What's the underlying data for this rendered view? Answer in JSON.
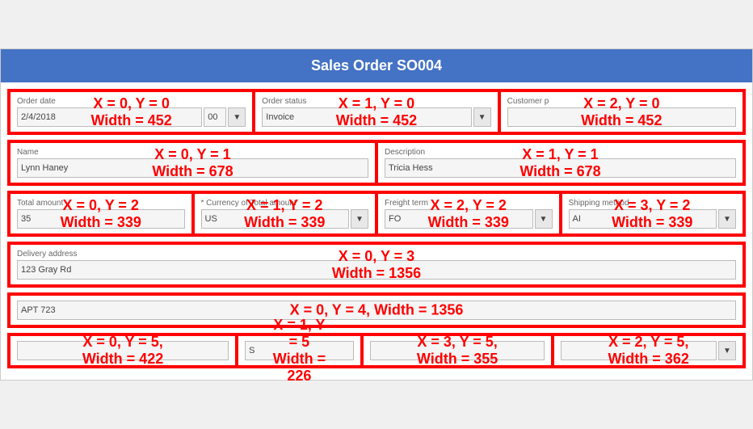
{
  "title": "Sales Order SO004",
  "rows": [
    {
      "id": "row0",
      "cells": [
        {
          "label": "Order date",
          "coords": "X = 0, Y = 0",
          "width": "Width = 452",
          "input_value": "2/4/2018",
          "has_time": true,
          "time_value": "00",
          "has_select": true
        },
        {
          "label": "Order status",
          "coords": "X = 1, Y = 0",
          "width": "Width = 452",
          "input_value": "Invoice",
          "has_select": true
        },
        {
          "label": "Customer p",
          "coords": "X = 2, Y = 0",
          "width": "Width = 452",
          "input_value": "",
          "has_select": false
        }
      ]
    },
    {
      "id": "row1",
      "cells": [
        {
          "label": "Name",
          "coords": "X = 0, Y = 1",
          "width": "Width = 678",
          "input_value": "Lynn Haney",
          "has_select": false
        },
        {
          "label": "Description",
          "coords": "X = 1, Y = 1",
          "width": "Width = 678",
          "input_value": "Tricia Hess",
          "has_select": false
        }
      ]
    },
    {
      "id": "row2",
      "cells": [
        {
          "label": "Total amount",
          "coords": "X = 0, Y = 2",
          "width": "Width = 339",
          "input_value": "35",
          "has_select": false
        },
        {
          "label": "* Currency of Total amount",
          "coords": "X = 1, Y = 2",
          "width": "Width = 339",
          "input_value": "US",
          "has_select": true
        },
        {
          "label": "Freight term",
          "coords": "X = 2, Y = 2",
          "width": "Width = 339",
          "input_value": "FO",
          "has_select": true
        },
        {
          "label": "Shipping method",
          "coords": "X = 3, Y = 2",
          "width": "Width = 339",
          "input_value": "AI",
          "has_select": true
        }
      ]
    },
    {
      "id": "row3",
      "cells": [
        {
          "label": "Delivery address",
          "coords": "X = 0, Y = 3",
          "width": "Width = 1356",
          "input_value": "123 Gray Rd",
          "has_select": false
        }
      ]
    },
    {
      "id": "row4",
      "cells": [
        {
          "label": "",
          "coords": "X = 0, Y = 4, Width = 1356",
          "width": "",
          "input_value": "APT 723",
          "has_select": false
        }
      ]
    }
  ],
  "row5": {
    "cells": [
      {
        "coords": "X = 0, Y = 5, Width = 422",
        "input_value": ""
      },
      {
        "coords": "X = 1, Y = 5\nWidth = 226",
        "input_value": "S"
      },
      {
        "coords": "X = 3, Y = 5, Width = 355",
        "input_value": ""
      },
      {
        "coords": "X = 2, Y = 5, Width = 362",
        "input_value": "",
        "has_select": true
      }
    ]
  }
}
